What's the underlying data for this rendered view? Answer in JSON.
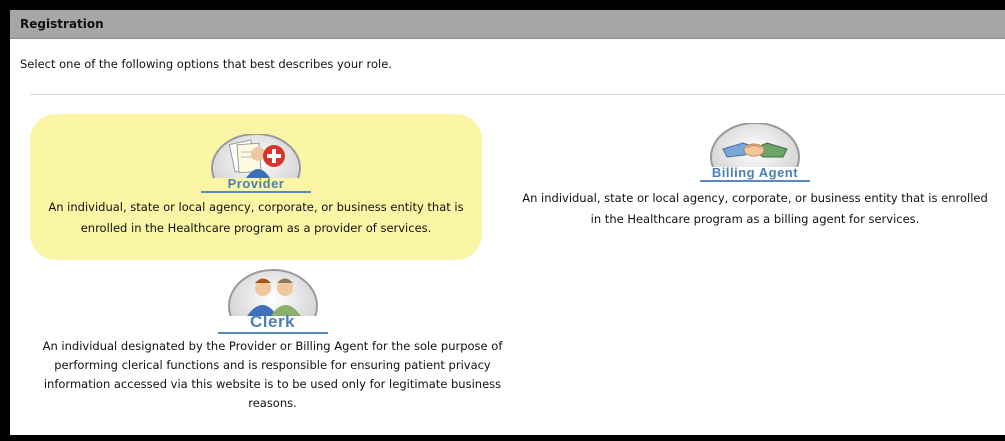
{
  "header": {
    "title": "Registration"
  },
  "intro": "Select one of the following options that best describes your role.",
  "roles": [
    {
      "label": "Provider",
      "icon": "provider-documents-icon",
      "description_lines": [
        "An individual, state or local agency, corporate, or business entity that is",
        "enrolled in the Healthcare program as a provider of services."
      ]
    },
    {
      "label": "Billing Agent",
      "icon": "handshake-icon",
      "description_lines": [
        "An individual, state or local agency, corporate, or business entity that is enrolled",
        "in the Healthcare program as a billing agent for services."
      ]
    },
    {
      "label": "Clerk",
      "icon": "two-people-icon",
      "description_lines": [
        "An individual designated by the Provider or Billing Agent for the sole purpose of",
        "performing clerical functions and is responsible for ensuring patient privacy",
        "information accessed via this website is to be used only for legitimate business",
        "reasons."
      ]
    }
  ],
  "colors": {
    "highlight": "#fbf6a6",
    "label_blue": "#4a7fb7",
    "titlebar": "#a6a6a6"
  }
}
